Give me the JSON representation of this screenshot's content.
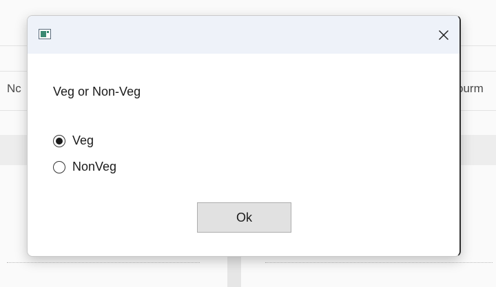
{
  "background": {
    "left_partial_text": "Nc",
    "right_partial_text": "ourm"
  },
  "dialog": {
    "title_icon": "app-window-icon",
    "close_icon": "close-icon",
    "prompt": "Veg or Non-Veg",
    "options": [
      {
        "label": "Veg",
        "selected": true
      },
      {
        "label": "NonVeg",
        "selected": false
      }
    ],
    "ok_label": "Ok"
  },
  "colors": {
    "titlebar": "#eef2f9",
    "button_face": "#e1e1e1",
    "icon_green": "#3c8a73"
  }
}
